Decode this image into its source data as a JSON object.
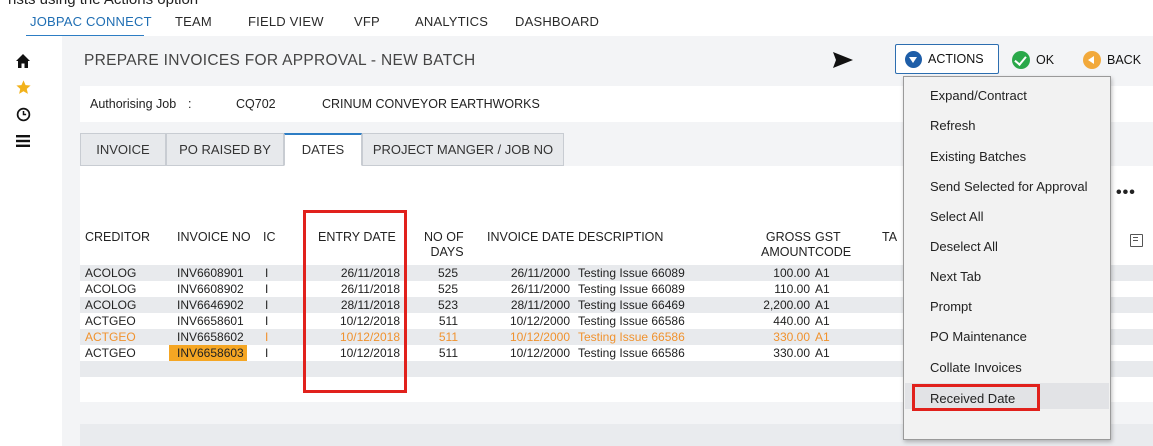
{
  "top_text": "nsts using the Actions option",
  "nav": {
    "items": [
      {
        "label": "JOBPAC CONNECT",
        "active": true
      },
      {
        "label": "TEAM"
      },
      {
        "label": "FIELD VIEW"
      },
      {
        "label": "VFP"
      },
      {
        "label": "ANALYTICS"
      },
      {
        "label": "DASHBOARD"
      }
    ]
  },
  "rail": {
    "icons": [
      "home-icon",
      "star-icon",
      "clock-icon",
      "menu-icon"
    ]
  },
  "page": {
    "title": "PREPARE INVOICES FOR APPROVAL - NEW BATCH",
    "actions_label": "ACTIONS",
    "ok_label": "OK",
    "back_label": "BACK"
  },
  "job": {
    "label": "Authorising Job",
    "colon": ":",
    "code": "CQ702",
    "name": "CRINUM CONVEYOR EARTHWORKS"
  },
  "tabs": [
    {
      "label": "INVOICE"
    },
    {
      "label": "PO RAISED BY"
    },
    {
      "label": "DATES",
      "active": true
    },
    {
      "label": "PROJECT MANGER / JOB NO"
    }
  ],
  "table": {
    "headers": {
      "creditor": "CREDITOR",
      "invoice_no": "INVOICE NO",
      "ic": "IC",
      "entry_date": "ENTRY DATE",
      "no_of_days_1": "NO OF",
      "no_of_days_2": "DAYS",
      "invoice_date": "INVOICE DATE",
      "description": "DESCRIPTION",
      "gross_1": "GROSS",
      "gross_2": "AMOUNT",
      "gst_1": "GST",
      "gst_2": "CODE",
      "ta": "TA"
    },
    "rows": [
      {
        "creditor": "ACOLOG",
        "invoice_no": "INV6608901",
        "ic": "I",
        "entry_date": "26/11/2018",
        "days": "525",
        "invoice_date": "26/11/2000",
        "description": "Testing Issue 66089",
        "gross": "100.00",
        "gst": "A1"
      },
      {
        "creditor": "ACOLOG",
        "invoice_no": "INV6608902",
        "ic": "I",
        "entry_date": "26/11/2018",
        "days": "525",
        "invoice_date": "26/11/2000",
        "description": "Testing Issue 66089",
        "gross": "110.00",
        "gst": "A1"
      },
      {
        "creditor": "ACOLOG",
        "invoice_no": "INV6646902",
        "ic": "I",
        "entry_date": "28/11/2018",
        "days": "523",
        "invoice_date": "28/11/2000",
        "description": "Testing Issue 66469",
        "gross": "2,200.00",
        "gst": "A1"
      },
      {
        "creditor": "ACTGEO",
        "invoice_no": "INV6658601",
        "ic": "I",
        "entry_date": "10/12/2018",
        "days": "511",
        "invoice_date": "10/12/2000",
        "description": "Testing Issue 66586",
        "gross": "440.00",
        "gst": "A1"
      },
      {
        "creditor": "ACTGEO",
        "invoice_no": "INV6658602",
        "ic": "I",
        "entry_date": "10/12/2018",
        "days": "511",
        "invoice_date": "10/12/2000",
        "description": "Testing Issue 66586",
        "gross": "330.00",
        "gst": "A1"
      },
      {
        "creditor": "ACTGEO",
        "invoice_no": "INV6658603",
        "ic": "I",
        "entry_date": "10/12/2018",
        "days": "511",
        "invoice_date": "10/12/2000",
        "description": "Testing Issue 66586",
        "gross": "330.00",
        "gst": "A1"
      }
    ]
  },
  "menu": {
    "items": [
      "Expand/Contract",
      "Refresh",
      "Existing Batches",
      "Send Selected for Approval",
      "Select All",
      "Deselect All",
      "Next Tab",
      "Prompt",
      "PO Maintenance",
      "Collate Invoices",
      "Received Date"
    ]
  },
  "colors": {
    "accent": "#2d7dc4",
    "highlight_red": "#e1211c",
    "orange_row": "#f0922e",
    "selected_cell": "#f5a623",
    "ok_green": "#2aa84a",
    "back_orange": "#f2a93b"
  },
  "extras": {
    "more_glyph": "•••"
  }
}
